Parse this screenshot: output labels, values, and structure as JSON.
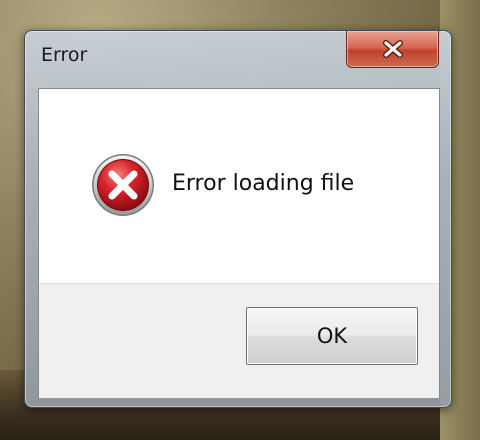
{
  "window": {
    "title": "Error"
  },
  "title_bar": {
    "close_icon": "close-icon"
  },
  "message": {
    "icon": "error-icon",
    "text": "Error loading file"
  },
  "buttons": {
    "ok_label": "OK"
  },
  "colors": {
    "error_red": "#c8161d",
    "close_button_red": "#c7442e"
  }
}
